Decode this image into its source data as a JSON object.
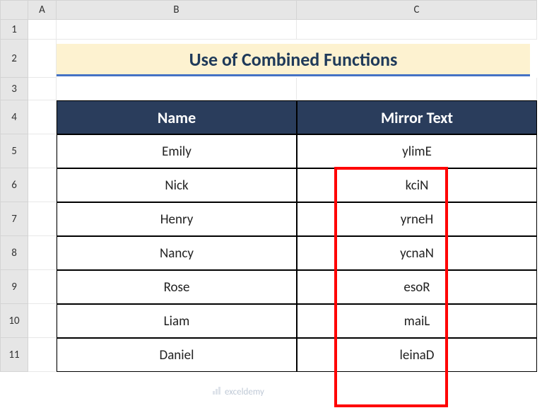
{
  "columns": [
    "A",
    "B",
    "C"
  ],
  "rows": [
    "1",
    "2",
    "3",
    "4",
    "5",
    "6",
    "7",
    "8",
    "9",
    "10",
    "11"
  ],
  "title": "Use of Combined Functions",
  "headers": {
    "name": "Name",
    "mirror": "Mirror Text"
  },
  "chart_data": {
    "type": "table",
    "title": "Use of Combined Functions",
    "columns": [
      "Name",
      "Mirror Text"
    ],
    "rows": [
      {
        "name": "Emily",
        "mirror": "ylimE"
      },
      {
        "name": "Nick",
        "mirror": "kciN"
      },
      {
        "name": "Henry",
        "mirror": "yrneH"
      },
      {
        "name": "Nancy",
        "mirror": "ycnaN"
      },
      {
        "name": "Rose",
        "mirror": "esoR"
      },
      {
        "name": "Liam",
        "mirror": "maiL"
      },
      {
        "name": "Daniel",
        "mirror": "leinaD"
      }
    ]
  },
  "watermark": "exceldemy"
}
